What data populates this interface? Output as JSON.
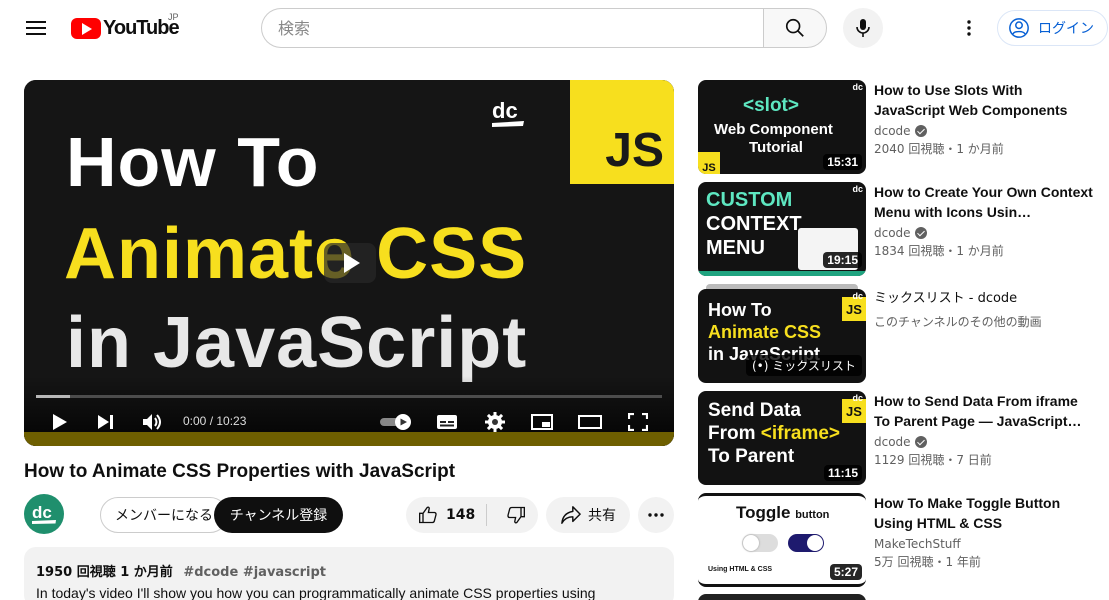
{
  "header": {
    "logo_text": "YouTube",
    "logo_region": "JP",
    "search_placeholder": "検索",
    "login_label": "ログイン"
  },
  "player": {
    "thumb_line1": "How To",
    "thumb_line2": "Animate CSS",
    "thumb_line3": "in JavaScript",
    "js_badge": "JS",
    "time": "0:00 / 10:23",
    "progress_fraction": 0.0
  },
  "video": {
    "title": "How to Animate CSS Properties with JavaScript",
    "member_label": "メンバーになる",
    "subscribe_label": "チャンネル登録",
    "like_count": "148",
    "share_label": "共有",
    "description_meta": "1950 回視聴  1 か月前",
    "description_tags": "#dcode #javascript",
    "description_text": "In today's video I'll show you how you can programmatically animate CSS properties using"
  },
  "recommendations": [
    {
      "title": "How to Use Slots With JavaScript Web Components",
      "channel": "dcode",
      "verified": true,
      "meta": "2040 回視聴・1 か月前",
      "duration": "15:31",
      "thumb_lines": [
        "<slot>",
        "Web Component",
        "Tutorial"
      ]
    },
    {
      "title": "How to Create Your Own Context Menu with Icons Usin…",
      "channel": "dcode",
      "verified": true,
      "meta": "1834 回視聴・1 か月前",
      "duration": "19:15",
      "thumb_lines": [
        "CUSTOM",
        "CONTEXT",
        "MENU"
      ]
    },
    {
      "title": "ミックスリスト - dcode",
      "channel": "このチャンネルのその他の動画",
      "verified": false,
      "meta": "",
      "duration": "",
      "overlay": "(•) ミックスリスト",
      "thumb_lines": [
        "How To",
        "Animate CSS",
        "in JavaScript"
      ]
    },
    {
      "title": "How to Send Data From iframe To Parent Page — JavaScript…",
      "channel": "dcode",
      "verified": true,
      "meta": "1129 回視聴・7 日前",
      "duration": "11:15",
      "thumb_lines": [
        "Send Data",
        "From <iframe>",
        "To Parent"
      ]
    },
    {
      "title": "How To Make Toggle Button Using HTML & CSS",
      "channel": "MakeTechStuff",
      "verified": false,
      "meta": "5万 回視聴・1 年前",
      "duration": "5:27",
      "thumb_lines": [
        "Toggle",
        "button",
        "Using HTML & CSS"
      ]
    }
  ]
}
